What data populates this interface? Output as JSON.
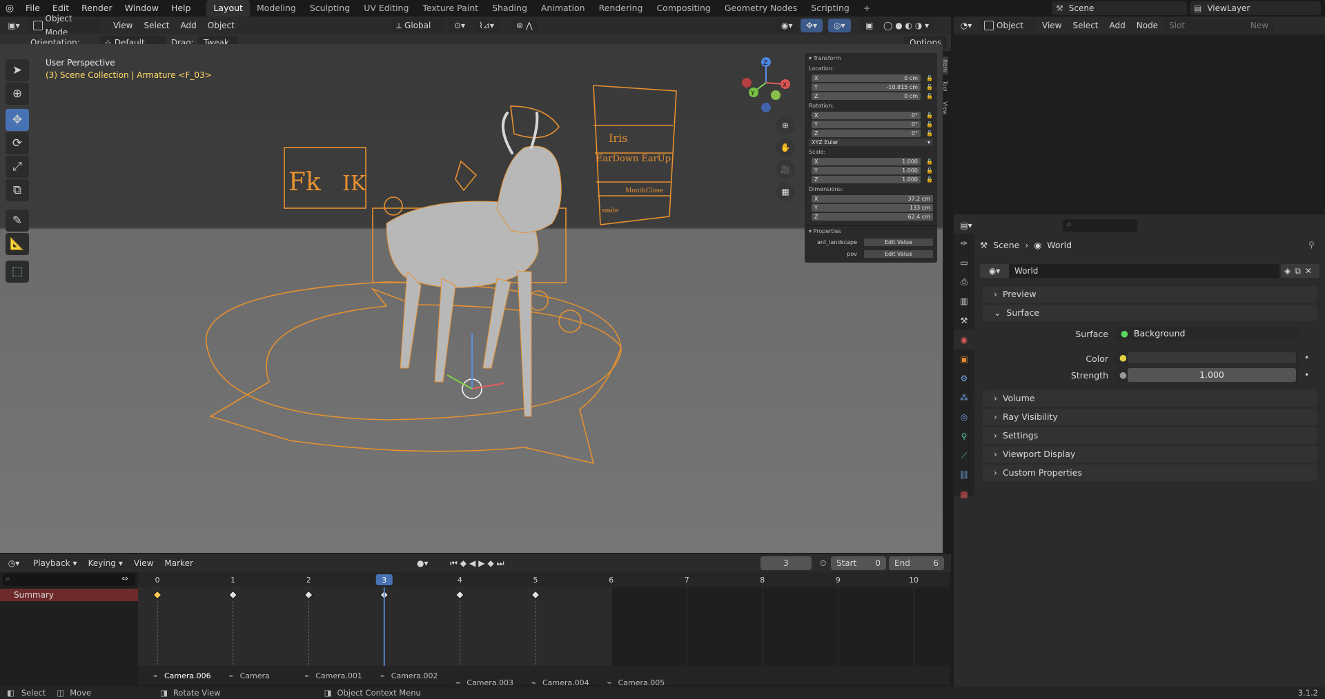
{
  "topbar": {
    "menus": [
      "File",
      "Edit",
      "Render",
      "Window",
      "Help"
    ],
    "workspaces": [
      "Layout",
      "Modeling",
      "Sculpting",
      "UV Editing",
      "Texture Paint",
      "Shading",
      "Animation",
      "Rendering",
      "Compositing",
      "Geometry Nodes",
      "Scripting"
    ],
    "active_workspace": "Layout",
    "add_tab": "+",
    "scene": "Scene",
    "view_layer": "ViewLayer"
  },
  "viewport_header": {
    "mode": "Object Mode",
    "menus": [
      "View",
      "Select",
      "Add",
      "Object"
    ],
    "transform_orientation": "Global",
    "orientation_label": "Orientation:",
    "orientation_value": "Default",
    "drag_label": "Drag:",
    "drag_value": "Tweak",
    "options": "Options"
  },
  "viewport": {
    "perspective": "User Perspective",
    "collection_info": "(3) Scene Collection | Armature <F_03>",
    "gizmo_axes": {
      "x": "X",
      "y": "Y",
      "z": "Z"
    },
    "rig_labels": {
      "fk": "Fk",
      "ik": "IK",
      "iris": "Iris",
      "ear": "EarDown EarUp",
      "mouth": "MouthClose",
      "smile": "smile"
    }
  },
  "npanel": {
    "tabs": [
      "Item",
      "Tool",
      "View"
    ],
    "transform_title": "Transform",
    "location_label": "Location:",
    "location": [
      {
        "axis": "X",
        "value": "0 cm"
      },
      {
        "axis": "Y",
        "value": "-10.815 cm"
      },
      {
        "axis": "Z",
        "value": "0 cm"
      }
    ],
    "rotation_label": "Rotation:",
    "rotation": [
      {
        "axis": "X",
        "value": "0°"
      },
      {
        "axis": "Y",
        "value": "0°"
      },
      {
        "axis": "Z",
        "value": "0°"
      }
    ],
    "rotation_mode": "XYZ Euler",
    "scale_label": "Scale:",
    "scale": [
      {
        "axis": "X",
        "value": "1.000"
      },
      {
        "axis": "Y",
        "value": "1.000"
      },
      {
        "axis": "Z",
        "value": "1.000"
      }
    ],
    "dimensions_label": "Dimensions:",
    "dimensions": [
      {
        "axis": "X",
        "value": "37.2 cm"
      },
      {
        "axis": "Y",
        "value": "133 cm"
      },
      {
        "axis": "Z",
        "value": "62.4 cm"
      }
    ],
    "properties_title": "Properties",
    "custom_props": [
      {
        "name": "ant_landscape",
        "button": "Edit Value"
      },
      {
        "name": "pov",
        "button": "Edit Value"
      }
    ]
  },
  "node_editor": {
    "type": "Object",
    "menus": [
      "View",
      "Select",
      "Add",
      "Node"
    ],
    "slot": "Slot",
    "new": "New"
  },
  "timeline": {
    "menus": [
      "Playback",
      "Keying",
      "View",
      "Marker"
    ],
    "current_frame": "3",
    "start_label": "Start",
    "start": "0",
    "end_label": "End",
    "end": "6",
    "frames": [
      "0",
      "1",
      "2",
      "3",
      "4",
      "5",
      "6",
      "7",
      "8",
      "9",
      "10"
    ],
    "keyframes": [
      0,
      1,
      2,
      3,
      4,
      5
    ],
    "summary": "Summary",
    "markers": [
      "Camera.006",
      "Camera",
      "Camera.001",
      "Camera.002",
      "Camera.003",
      "Camera.004",
      "Camera.005"
    ]
  },
  "properties": {
    "breadcrumb_scene": "Scene",
    "breadcrumb_world": "World",
    "world_name": "World",
    "sections": [
      "Preview",
      "Surface",
      "Volume",
      "Ray Visibility",
      "Settings",
      "Viewport Display",
      "Custom Properties"
    ],
    "surface_label": "Surface",
    "surface_value": "Background",
    "color_label": "Color",
    "strength_label": "Strength",
    "strength_value": "1.000"
  },
  "statusbar": {
    "select": "Select",
    "move": "Move",
    "rotate": "Rotate View",
    "context": "Object Context Menu",
    "version": "3.1.2"
  },
  "colors": {
    "accent": "#4772b3",
    "rig": "#e8912f",
    "selected_text": "#ffd966",
    "summary_bg": "#6e2a2a"
  }
}
